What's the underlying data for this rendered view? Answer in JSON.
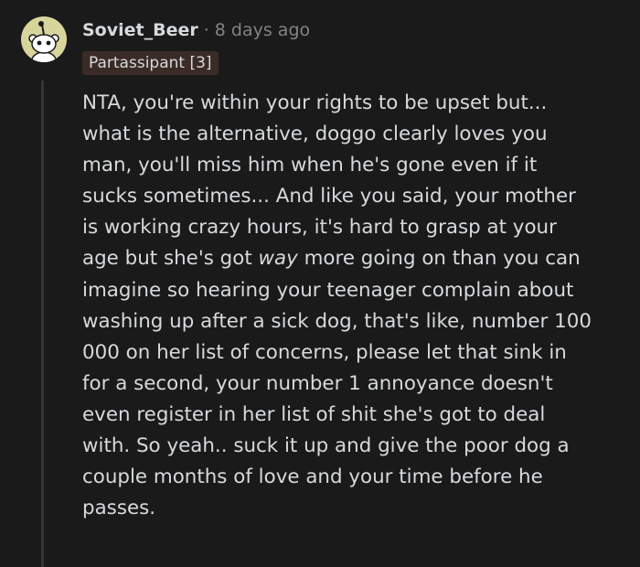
{
  "comment": {
    "author": "Soviet_Beer",
    "separator": "·",
    "timestamp": "8 days ago",
    "flair": "Partassipant [3]",
    "avatar_icon": "snoo-avatar-icon",
    "body_lines": [
      "NTA, you're within your rights to be upset but...",
      "what is the alternative, doggo clearly loves you",
      "man, you'll miss him when he's gone even if it",
      "sucks sometimes... And like you said, your mother",
      "is working crazy hours, it's hard to grasp at your",
      {
        "before": "age but she's got ",
        "emphasis": "way",
        "after": " more going on than you can"
      },
      "imagine so hearing your teenager complain about",
      "washing up after a sick dog, that's like, number 100",
      "000 on her list of concerns, please let that sink in",
      "for a second, your number 1 annoyance doesn't",
      "even register in her list of shit she's got to deal",
      "with. So yeah.. suck it up and give the poor dog a",
      "couple months of love and your time before he",
      "passes."
    ]
  },
  "colors": {
    "background": "#1a1a1b",
    "text": "#d7dadc",
    "meta": "#818384",
    "flair_bg": "#3b2b27",
    "thread_line": "#343536",
    "avatar_bg": "#d7d59b"
  }
}
